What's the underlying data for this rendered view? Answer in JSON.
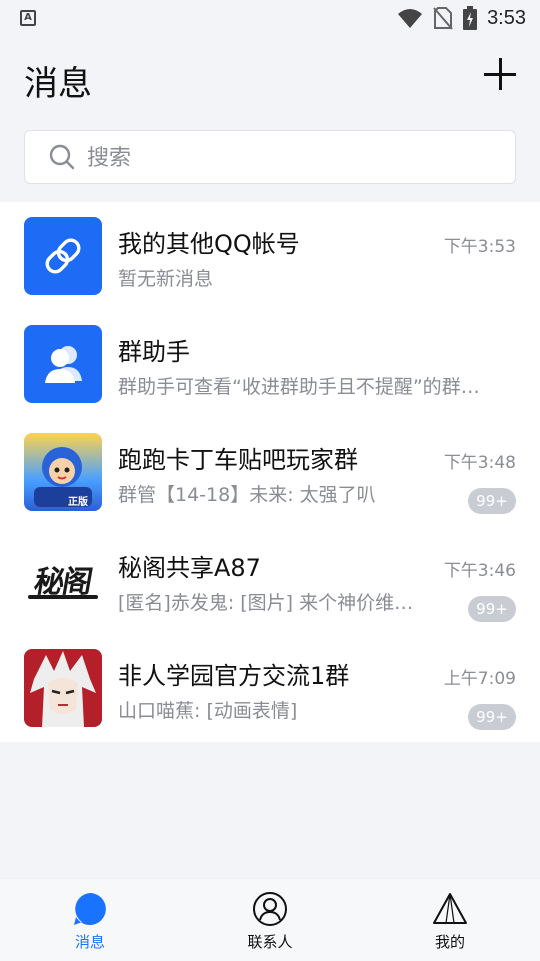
{
  "status_bar": {
    "time": "3:53",
    "app_icon_letter": "A"
  },
  "header": {
    "title": "消息",
    "add_icon": "plus-icon"
  },
  "search": {
    "placeholder": "搜索",
    "value": ""
  },
  "conversations": [
    {
      "name": "我的其他QQ帐号",
      "preview": "暂无新消息",
      "time": "下午3:53",
      "badge": "",
      "avatar": "link-icon"
    },
    {
      "name": "群助手",
      "preview": "群助手可查看“收进群助手且不提醒”的群…",
      "time": "",
      "badge": "",
      "avatar": "group-helper-icon"
    },
    {
      "name": "跑跑卡丁车贴吧玩家群",
      "preview": "群管【14-18】未来: 太强了叭",
      "time": "下午3:48",
      "badge": "99+",
      "avatar": "game-character-avatar",
      "avatar_text": "正版"
    },
    {
      "name": "秘阁共享A87",
      "preview": "[匿名]赤发鬼: [图片] 来个神价维…",
      "time": "下午3:46",
      "badge": "99+",
      "avatar": "calligraphy-logo-avatar",
      "avatar_text": "秘阁"
    },
    {
      "name": "非人学园官方交流1群",
      "preview": "山口喵蕉: [动画表情]",
      "time": "上午7:09",
      "badge": "99+",
      "avatar": "anime-character-avatar"
    }
  ],
  "bottom_nav": [
    {
      "label": "消息",
      "icon": "message-icon",
      "active": true
    },
    {
      "label": "联系人",
      "icon": "contacts-icon",
      "active": false
    },
    {
      "label": "我的",
      "icon": "profile-icon",
      "active": false
    }
  ],
  "colors": {
    "accent": "#1a73ff",
    "background": "#f3f4f8",
    "badge": "#c9ccd3"
  }
}
